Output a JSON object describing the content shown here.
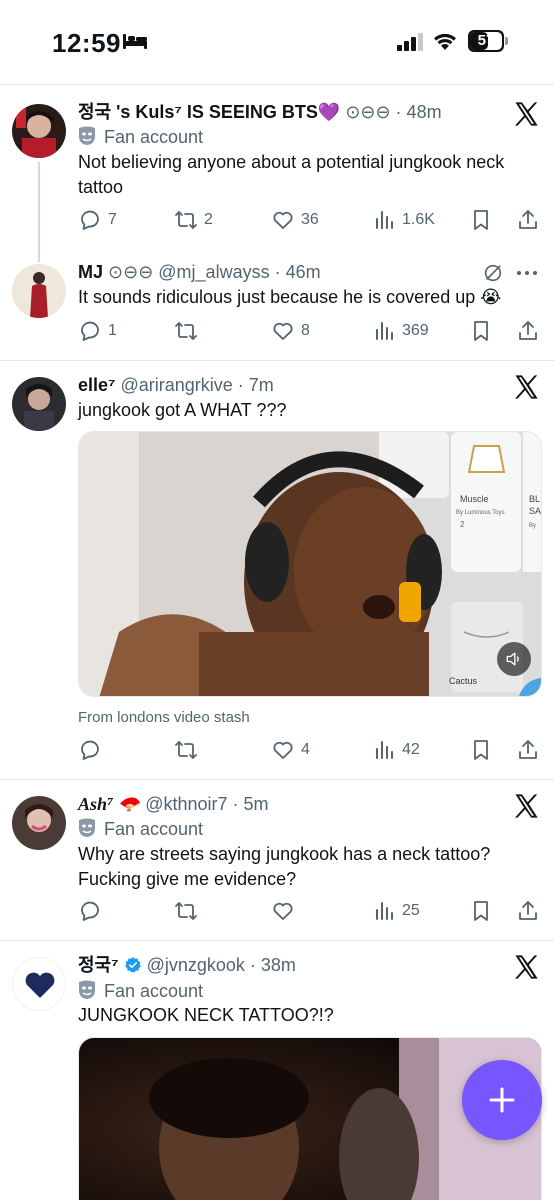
{
  "status_bar": {
    "time": "12:59",
    "battery": "57",
    "battery_level": 0.57
  },
  "colors": {
    "accent": "#1d9bf0",
    "fab": "#7856ff",
    "text": "#0f1419",
    "secondary": "#536471",
    "divider": "#e6e9eb"
  },
  "tweets": [
    {
      "name": "정국 's Kuls⁷ IS SEEING BTS💜",
      "handle_meta": "⊙⊖⊖ · 48m",
      "label": "Fan account",
      "text": "Not believing anyone about a potential jungkook neck tattoo",
      "replies": "7",
      "retweets": "2",
      "likes": "36",
      "views": "1.6K"
    },
    {
      "name": "MJ",
      "handle_meta": "⊙⊖⊖ @mj_alwayss · 46m",
      "text": "It sounds ridiculous just because he is covered up 😭",
      "replies": "1",
      "retweets": "",
      "likes": "8",
      "views": "369"
    },
    {
      "name": "elle⁷",
      "handle_meta": "@arirangrkive · 7m",
      "text": "jungkook got A WHAT ???",
      "media_texts": [
        "Muscle",
        "By Luminous Toys",
        "2",
        "BL",
        "SA",
        "By",
        "Cactus"
      ],
      "source": "From londons video stash",
      "replies": "",
      "retweets": "",
      "likes": "4",
      "views": "42"
    },
    {
      "name": "Ash⁷ 🪭",
      "handle_meta": "@kthnoir7 · 5m",
      "label": "Fan account",
      "text": "Why are streets saying jungkook has a neck tattoo? Fucking give me evidence?",
      "replies": "",
      "retweets": "",
      "likes": "",
      "views": "25"
    },
    {
      "name": "정국⁷",
      "handle_meta": "@jvnzgkook · 38m",
      "label": "Fan account",
      "text": "JUNGKOOK NECK TATTOO?!?"
    }
  ]
}
